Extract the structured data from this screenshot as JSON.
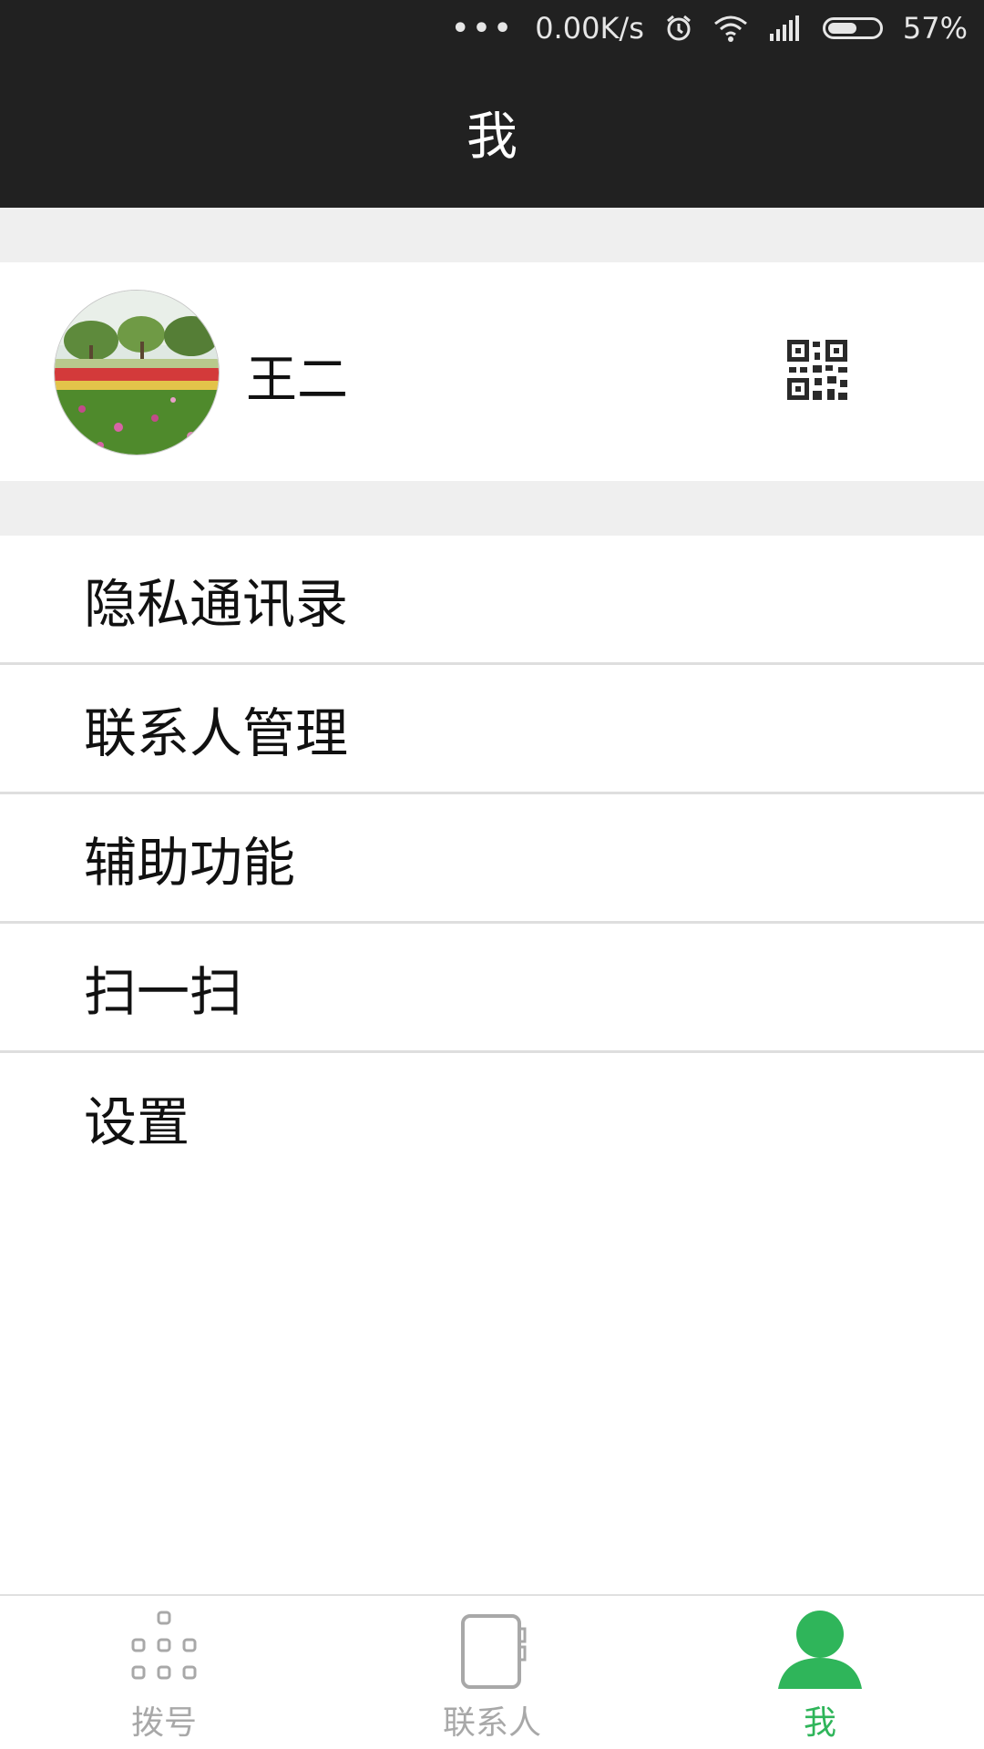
{
  "status_bar": {
    "dots": "•••",
    "network_speed": "0.00K/s",
    "alarm_icon": "alarm-icon",
    "wifi_icon": "wifi-icon",
    "signal_icon": "signal-icon",
    "battery_level": 0.57,
    "battery_text": "57%"
  },
  "header": {
    "title": "我"
  },
  "profile": {
    "name": "王二",
    "avatar_icon": "avatar-photo",
    "qr_icon": "qr-code-icon"
  },
  "menu": {
    "items": [
      {
        "label": "隐私通讯录"
      },
      {
        "label": "联系人管理"
      },
      {
        "label": "辅助功能"
      },
      {
        "label": "扫一扫"
      },
      {
        "label": "设置"
      }
    ]
  },
  "tabbar": {
    "tabs": [
      {
        "label": "拨号",
        "icon": "dialpad-icon",
        "active": false
      },
      {
        "label": "联系人",
        "icon": "contacts-book-icon",
        "active": false
      },
      {
        "label": "我",
        "icon": "person-icon",
        "active": true
      }
    ],
    "active_color": "#2fb55a",
    "inactive_color": "#a8a8a8"
  }
}
